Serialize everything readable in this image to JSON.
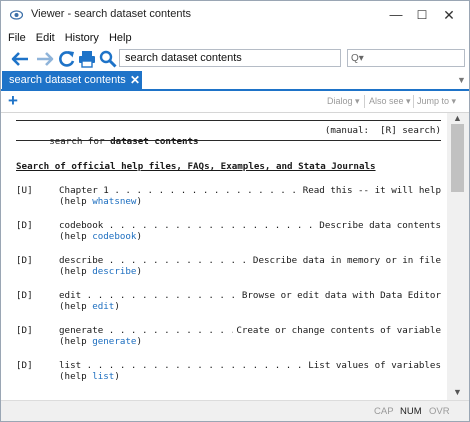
{
  "window": {
    "title": "Viewer - search dataset contents",
    "controls": {
      "minimize": "—",
      "maximize": "☐",
      "close": "✕"
    }
  },
  "menu": [
    "File",
    "Edit",
    "History",
    "Help"
  ],
  "toolbar": {
    "address_value": "search dataset contents",
    "search_placeholder": "",
    "search_icon_text": "Q▾"
  },
  "tabs": [
    {
      "label": "search dataset contents",
      "close": "✕",
      "active": true
    }
  ],
  "subtoolbar": {
    "add": "+",
    "dialog": "Dialog ▾",
    "also_see": "Also see ▾",
    "jump_to": "Jump to ▾"
  },
  "content": {
    "search_prefix": "search for ",
    "search_term": "dataset contents",
    "manual": "(manual:  [R] search)",
    "section_heading": "Search of official help files, FAQs, Examples, and Stata Journals",
    "entries": [
      {
        "tag": "[U]",
        "cmd": "Chapter 1",
        "dots": "Chapter 1 . . . . . . . . . . . . . . . . .",
        "desc": "Read this -- it will help",
        "help_prefix": "(help ",
        "help_link": "whatsnew",
        "help_suffix": ")"
      },
      {
        "tag": "[D]",
        "cmd": "codebook",
        "dots": "codebook . . . . . . . . . . . . . . . . . . . . . . .",
        "desc": "Describe data contents",
        "help_prefix": "(help ",
        "help_link": "codebook",
        "help_suffix": ")"
      },
      {
        "tag": "[D]",
        "cmd": "describe",
        "dots": "describe . . . . . . . . . . . . . . .",
        "desc": "Describe data in memory or in file",
        "help_prefix": "(help ",
        "help_link": "describe",
        "help_suffix": ")"
      },
      {
        "tag": "[D]",
        "cmd": "edit",
        "dots": "edit . . . . . . . . . . . . . . . . . . . . .",
        "desc": "Browse or edit data with Data Editor",
        "help_prefix": "(help ",
        "help_link": "edit",
        "help_suffix": ")"
      },
      {
        "tag": "[D]",
        "cmd": "generate",
        "dots": "generate . . . . . . . . . . . . . .",
        "desc": "Create or change contents of variable",
        "help_prefix": "(help ",
        "help_link": "generate",
        "help_suffix": ")"
      },
      {
        "tag": "[D]",
        "cmd": "list",
        "dots": "list . . . . . . . . . . . . . . . . . . . . . . . . . . . .",
        "desc": "List values of variables",
        "help_prefix": "(help ",
        "help_link": "list",
        "help_suffix": ")"
      }
    ]
  },
  "statusbar": {
    "cap": "CAP",
    "num": "NUM",
    "ovr": "OVR"
  },
  "colors": {
    "accent": "#1e73c8",
    "link": "#1e6fc0"
  }
}
